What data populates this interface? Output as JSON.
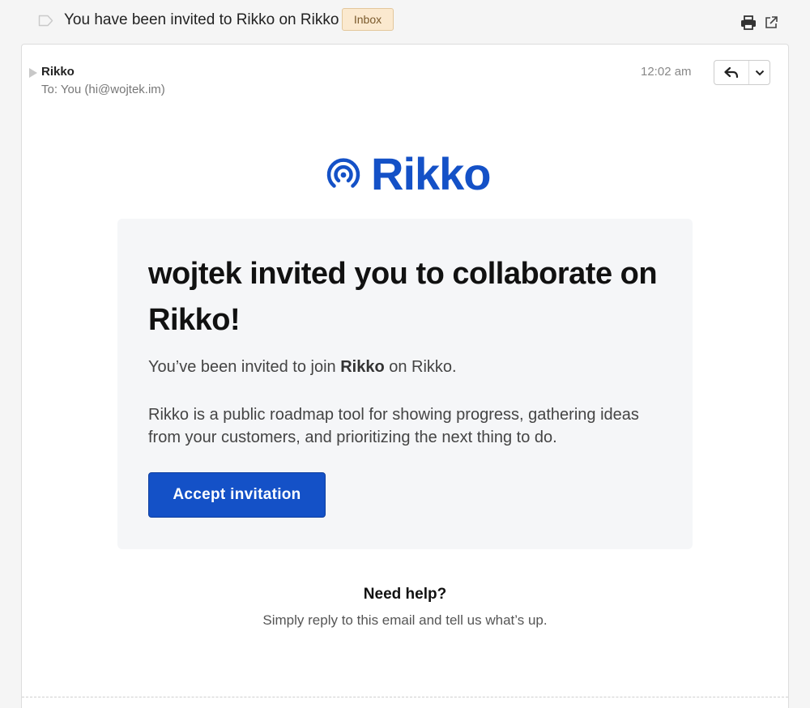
{
  "thread": {
    "subject": "You have been invited to Rikko on Rikko",
    "badge": "Inbox"
  },
  "message": {
    "sender": "Rikko",
    "recipient": "To: You (hi@wojtek.im)",
    "time": "12:02 am"
  },
  "email_body": {
    "logo_text": "Rikko",
    "heading": "wojtek invited you to collaborate on Rikko!",
    "intro_prefix": "You’ve been invited to join ",
    "intro_bold": "Rikko",
    "intro_suffix": " on Rikko.",
    "description": "Rikko is a public roadmap tool for showing progress, gathering ideas from your customers, and prioritizing the next thing to do.",
    "cta_label": "Accept invitation",
    "help_title": "Need help?",
    "help_text": "Simply reply to this email and tell us what’s up."
  },
  "colors": {
    "brand": "#1451c7",
    "badge_bg": "#fbe9cf",
    "panel_bg": "#f5f6f8"
  },
  "icons": [
    "label-tag-icon",
    "print-icon",
    "popout-icon",
    "expand-caret-icon",
    "reply-icon",
    "chevron-down-icon",
    "rikko-logo-icon"
  ]
}
